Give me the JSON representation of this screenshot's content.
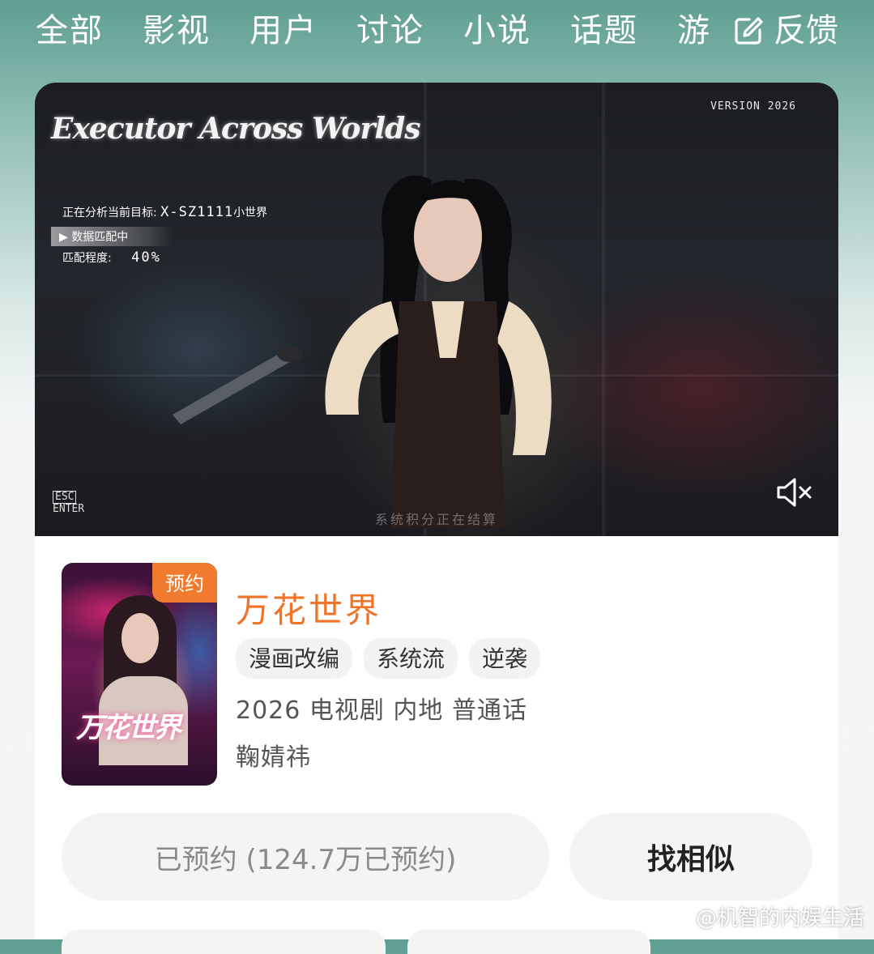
{
  "tabs": [
    "全部",
    "影视",
    "用户",
    "讨论",
    "小说",
    "话题",
    "游"
  ],
  "feedback_label": "反馈",
  "banner": {
    "logo_text": "Executor Across Worlds",
    "version": "VERSION 2026",
    "hud_analyzing_label": "正在分析当前目标:",
    "hud_target": "X-SZ1111",
    "hud_target_suffix": "小世界",
    "hud_matching": "数据匹配中",
    "hud_match_label": "匹配程度:",
    "hud_match_value": "40%",
    "esc": "ESC",
    "enter": "ENTER",
    "subtitle": "系统积分正在结算"
  },
  "card": {
    "badge": "预约",
    "poster_title": "万花世界",
    "title": "万花世界",
    "tags": [
      "漫画改编",
      "系统流",
      "逆袭"
    ],
    "meta": "2026 电视剧 内地 普通话",
    "cast": "鞠婧祎",
    "reserved_button": "已预约 (124.7万已预约)",
    "similar_button": "找相似"
  },
  "watermark": "@机智的内娱生活",
  "colors": {
    "accent": "#f07326",
    "header": "#5f9e92"
  }
}
